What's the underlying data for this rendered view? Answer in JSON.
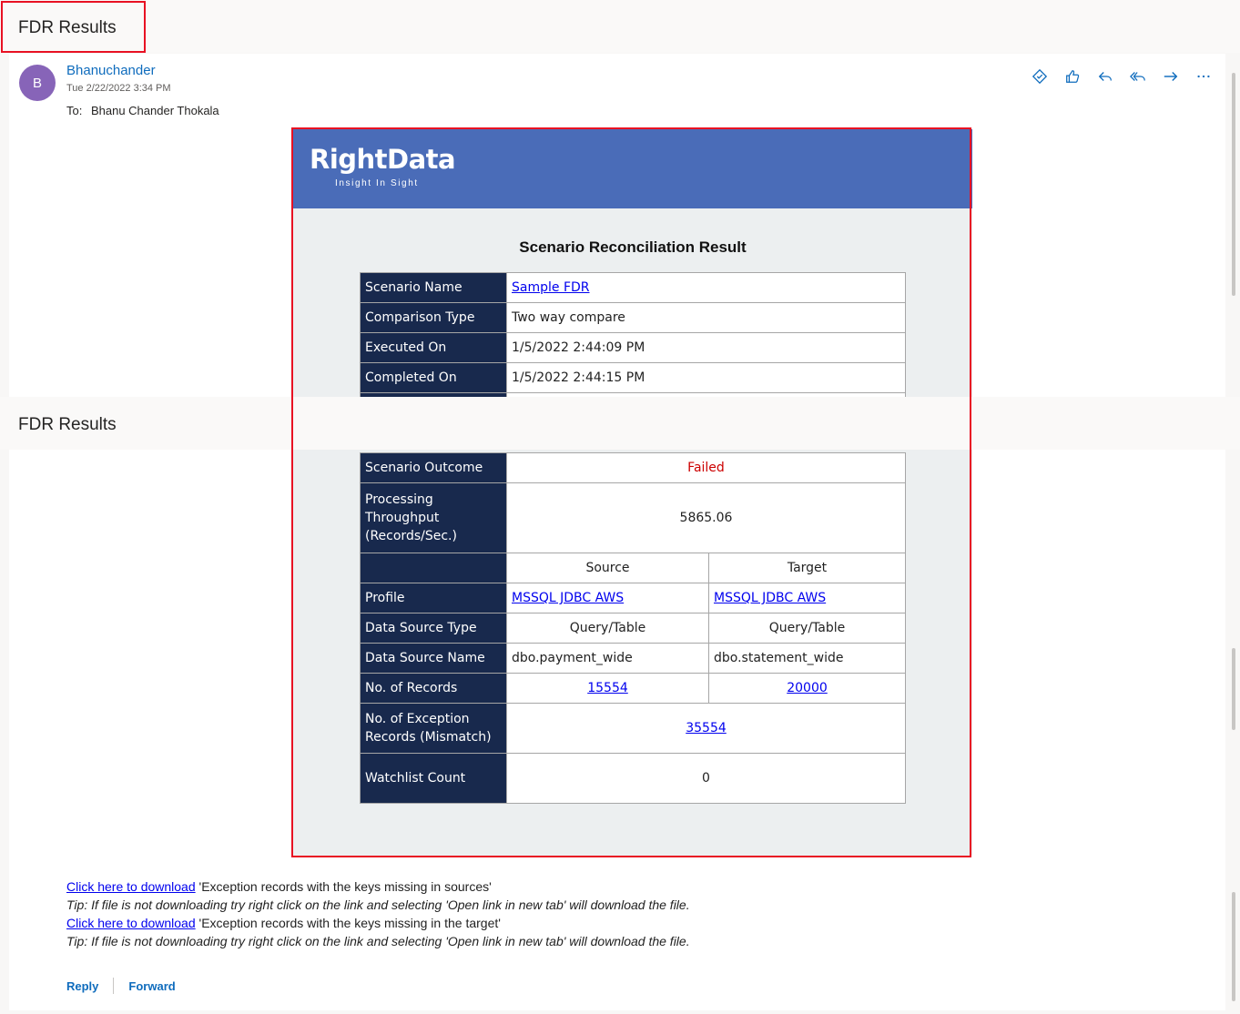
{
  "subject": "FDR Results",
  "message": {
    "sender": "Bhanuchander",
    "avatar_initial": "B",
    "date": "Tue 2/22/2022 3:34 PM",
    "to_label": "To:",
    "to_name": "Bhanu Chander Thokala"
  },
  "actions": [
    {
      "name": "immersive-reader-icon"
    },
    {
      "name": "like-icon"
    },
    {
      "name": "reply-icon"
    },
    {
      "name": "reply-all-icon"
    },
    {
      "name": "forward-icon"
    },
    {
      "name": "more-icon"
    }
  ],
  "logo": {
    "name": "RightData",
    "tagline": "Insight In Sight"
  },
  "result_title": "Scenario Reconciliation Result",
  "table": {
    "scenario_name_label": "Scenario Name",
    "scenario_name": "Sample FDR",
    "comparison_type_label": "Comparison Type",
    "comparison_type": "Two way compare",
    "executed_on_label": "Executed On",
    "executed_on": "1/5/2022 2:44:09 PM",
    "completed_on_label": "Completed On",
    "completed_on": "1/5/2022 2:44:15 PM",
    "outcome_label": "Scenario Outcome",
    "outcome": "Failed",
    "throughput_label_1": "Processing",
    "throughput_label_2": "Throughput",
    "throughput_label_3": "(Records/Sec.)",
    "throughput": "5865.06",
    "source_header": "Source",
    "target_header": "Target",
    "profile_label": "Profile",
    "source_profile": "MSSQL JDBC AWS",
    "target_profile": "MSSQL JDBC AWS",
    "ds_type_label": "Data Source Type",
    "source_ds_type": "Query/Table",
    "target_ds_type": "Query/Table",
    "ds_name_label": "Data Source Name",
    "source_ds_name": "dbo.payment_wide",
    "target_ds_name": "dbo.statement_wide",
    "records_label": "No. of Records",
    "source_records": "15554",
    "target_records": "20000",
    "exception_label_1": "No. of Exception",
    "exception_label_2": "Records (Mismatch)",
    "exception_records": "35554",
    "watchlist_label": "Watchlist Count",
    "watchlist_count": "0"
  },
  "downloads": {
    "link_text": "Click here to download",
    "desc_sources": " 'Exception records with the keys missing in sources'",
    "desc_target": " 'Exception records with the keys missing in the target'",
    "tip": "Tip: If file is not downloading try right click on the link and selecting 'Open link in new tab' will download the file."
  },
  "footer": {
    "reply": "Reply",
    "forward": "Forward"
  },
  "colors": {
    "banner": "#4a6cb8",
    "header_cell": "#18294d",
    "fail": "#c00000",
    "accent": "#0f6cbd"
  }
}
